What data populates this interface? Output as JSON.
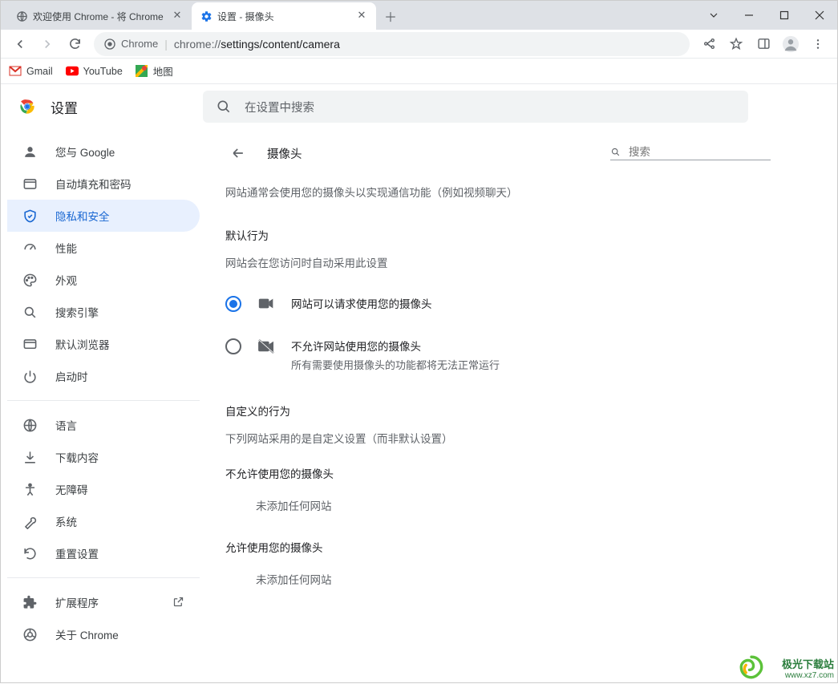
{
  "window": {
    "tabs": [
      {
        "title": "欢迎使用 Chrome - 将 Chrome",
        "active": false
      },
      {
        "title": "设置 - 摄像头",
        "active": true
      }
    ]
  },
  "toolbar": {
    "chrome_label": "Chrome",
    "url_prefix": "chrome://",
    "url_path": "settings/content/camera"
  },
  "bookmarks": [
    {
      "label": "Gmail"
    },
    {
      "label": "YouTube"
    },
    {
      "label": "地图"
    }
  ],
  "header": {
    "title": "设置",
    "search_placeholder": "在设置中搜索"
  },
  "sidebar": {
    "groups": [
      [
        {
          "key": "you",
          "label": "您与 Google"
        },
        {
          "key": "autofill",
          "label": "自动填充和密码"
        },
        {
          "key": "privacy",
          "label": "隐私和安全",
          "active": true
        },
        {
          "key": "perf",
          "label": "性能"
        },
        {
          "key": "appearance",
          "label": "外观"
        },
        {
          "key": "search",
          "label": "搜索引擎"
        },
        {
          "key": "default",
          "label": "默认浏览器"
        },
        {
          "key": "startup",
          "label": "启动时"
        }
      ],
      [
        {
          "key": "lang",
          "label": "语言"
        },
        {
          "key": "downloads",
          "label": "下载内容"
        },
        {
          "key": "a11y",
          "label": "无障碍"
        },
        {
          "key": "system",
          "label": "系统"
        },
        {
          "key": "reset",
          "label": "重置设置"
        }
      ],
      [
        {
          "key": "ext",
          "label": "扩展程序",
          "external": true
        },
        {
          "key": "about",
          "label": "关于 Chrome"
        }
      ]
    ]
  },
  "content": {
    "page_title": "摄像头",
    "search_placeholder": "搜索",
    "intro": "网站通常会使用您的摄像头以实现通信功能（例如视频聊天）",
    "default_label": "默认行为",
    "default_sub": "网站会在您访问时自动采用此设置",
    "options": [
      {
        "label": "网站可以请求使用您的摄像头",
        "sub": "",
        "checked": true,
        "icon": "camera"
      },
      {
        "label": "不允许网站使用您的摄像头",
        "sub": "所有需要使用摄像头的功能都将无法正常运行",
        "checked": false,
        "icon": "camera-off"
      }
    ],
    "custom_label": "自定义的行为",
    "custom_sub": "下列网站采用的是自定义设置（而非默认设置）",
    "block_label": "不允许使用您的摄像头",
    "block_empty": "未添加任何网站",
    "allow_label": "允许使用您的摄像头",
    "allow_empty": "未添加任何网站"
  },
  "watermark": {
    "line1": "极光下载站",
    "line2": "www.xz7.com"
  }
}
